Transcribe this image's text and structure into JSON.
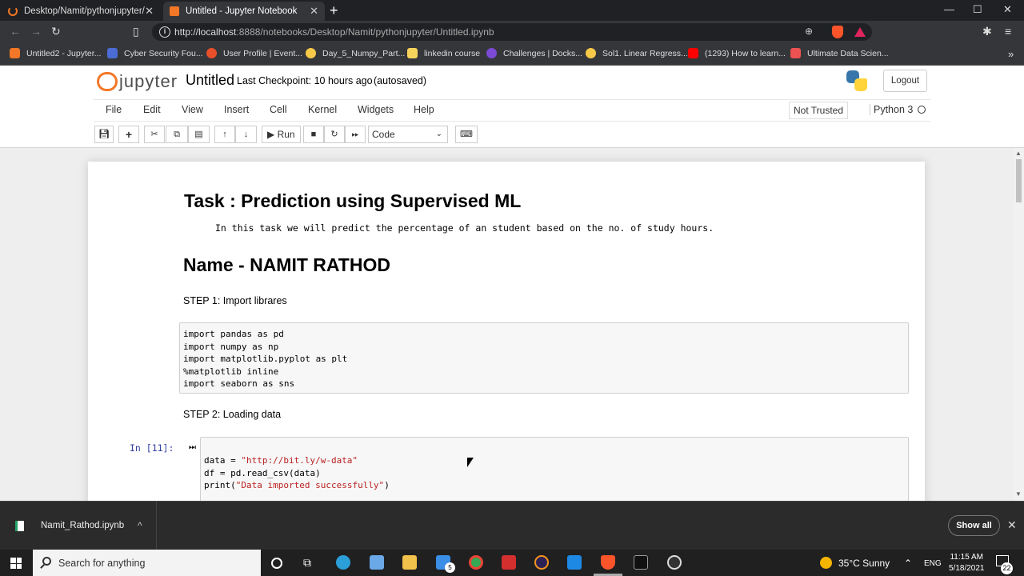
{
  "browser": {
    "tabs": [
      {
        "label": "Desktop/Namit/pythonjupyter/"
      },
      {
        "label": "Untitled - Jupyter Notebook"
      }
    ],
    "url_host": "http://localhost",
    "url_rest": ":8888/notebooks/Desktop/Namit/pythonjupyter/Untitled.ipynb",
    "bookmarks": [
      {
        "label": "Untitled2 - Jupyter...",
        "color": "#f37726"
      },
      {
        "label": "Cyber Security Fou...",
        "color": "#4a6cd4"
      },
      {
        "label": "User Profile | Event...",
        "color": "#e8502a"
      },
      {
        "label": "Day_5_Numpy_Part...",
        "color": "#f7c948"
      },
      {
        "label": "linkedin course",
        "color": "#f7d35c"
      },
      {
        "label": "Challenges | Docks...",
        "color": "#7b4bd6"
      },
      {
        "label": "Sol1. Linear Regress...",
        "color": "#f7c948"
      },
      {
        "label": "(1293) How to learn...",
        "color": "#ff0000"
      },
      {
        "label": "Ultimate Data Scien...",
        "color": "#ec5252"
      }
    ]
  },
  "jupyter": {
    "logo_text": "jupyter",
    "notebook_name": "Untitled",
    "checkpoint": "Last Checkpoint: 10 hours ago",
    "autosave": "(autosaved)",
    "logout": "Logout",
    "menu": [
      "File",
      "Edit",
      "View",
      "Insert",
      "Cell",
      "Kernel",
      "Widgets",
      "Help"
    ],
    "trust": "Not Trusted",
    "kernel": "Python 3",
    "toolbar": {
      "run_label": "Run",
      "cell_type": "Code"
    }
  },
  "notebook": {
    "title": "Task : Prediction using Supervised ML",
    "description": "In this task we will predict the percentage of an student based on the no. of study hours.",
    "name_heading": "Name - NAMIT RATHOD",
    "step1": "STEP 1: Import librares",
    "cell1_lines": [
      "import pandas as pd",
      "import numpy as np",
      "import matplotlib.pyplot as plt",
      "%matplotlib inline",
      "import seaborn as sns"
    ],
    "step2": "STEP 2: Loading data",
    "cell2_prompt": "In [11]:",
    "cell2_line1_prefix": "data = ",
    "cell2_line1_str": "\"http://bit.ly/w-data\"",
    "cell2_line2": "df = pd.read_csv(data)",
    "cell2_line3_prefix": "print(",
    "cell2_line3_str": "\"Data imported successfully\"",
    "cell2_line3_suffix": ")"
  },
  "downloads": {
    "file": "Namit_Rathod.ipynb",
    "show_all": "Show all"
  },
  "taskbar": {
    "search_placeholder": "Search for anything",
    "weather": "35°C  Sunny",
    "lang": "ENG",
    "time": "11:15 AM",
    "date": "5/18/2021",
    "notifications": "22",
    "mail_badge": "5"
  }
}
